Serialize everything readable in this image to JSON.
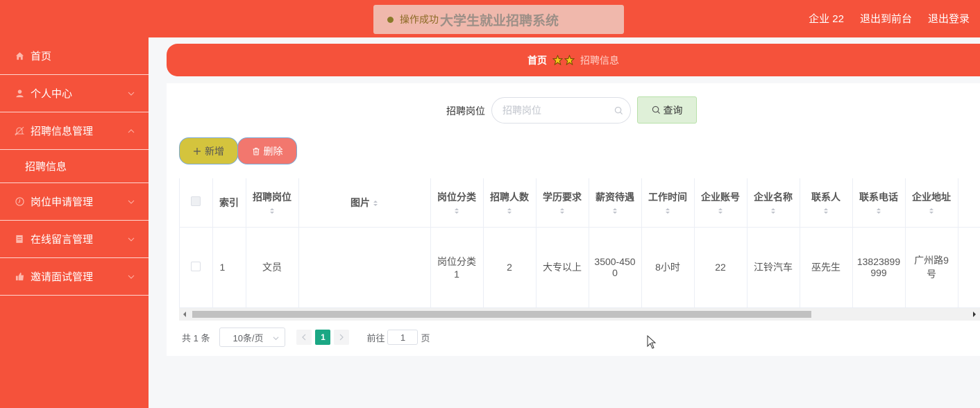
{
  "header": {
    "toast_message": "操作成功",
    "app_title": "大学生就业招聘系统",
    "user_label": "企业 22",
    "front_link": "退出到前台",
    "logout_link": "退出登录"
  },
  "sidebar": {
    "items": [
      {
        "label": "首页",
        "icon": "home-icon"
      },
      {
        "label": "个人中心",
        "icon": "user-icon"
      },
      {
        "label": "招聘信息管理",
        "icon": "mute-icon"
      },
      {
        "label": "招聘信息",
        "icon": ""
      },
      {
        "label": "岗位申请管理",
        "icon": "clock-icon"
      },
      {
        "label": "在线留言管理",
        "icon": "document-icon"
      },
      {
        "label": "邀请面试管理",
        "icon": "thumbs-up-icon"
      }
    ]
  },
  "breadcrumb": {
    "home": "首页",
    "current": "招聘信息"
  },
  "search": {
    "label": "招聘岗位",
    "placeholder": "招聘岗位",
    "value": "",
    "button_label": "查询"
  },
  "actions": {
    "add_label": "新增",
    "delete_label": "删除"
  },
  "table": {
    "columns": [
      "索引",
      "招聘岗位",
      "图片",
      "岗位分类",
      "招聘人数",
      "学历要求",
      "薪资待遇",
      "工作时间",
      "企业账号",
      "企业名称",
      "联系人",
      "联系电话",
      "企业地址"
    ],
    "rows": [
      {
        "index": "1",
        "position": "文员",
        "image": "",
        "category": "岗位分类1",
        "headcount": "2",
        "education": "大专以上",
        "salary": "3500-4500",
        "work_hours": "8小时",
        "account": "22",
        "company": "江铃汽车",
        "contact": "巫先生",
        "phone": "13823899999",
        "address": "广州路9号"
      }
    ]
  },
  "pagination": {
    "total": "共 1 条",
    "page_size": "10条/页",
    "current_page": "1",
    "goto_prefix": "前往",
    "goto_value": "1",
    "goto_suffix": "页"
  },
  "colors": {
    "primary": "#f5523b",
    "add_button": "#d4c43d",
    "delete_button": "#f2776e",
    "query_button": "#dff0d8",
    "page_active": "#1ba784"
  }
}
